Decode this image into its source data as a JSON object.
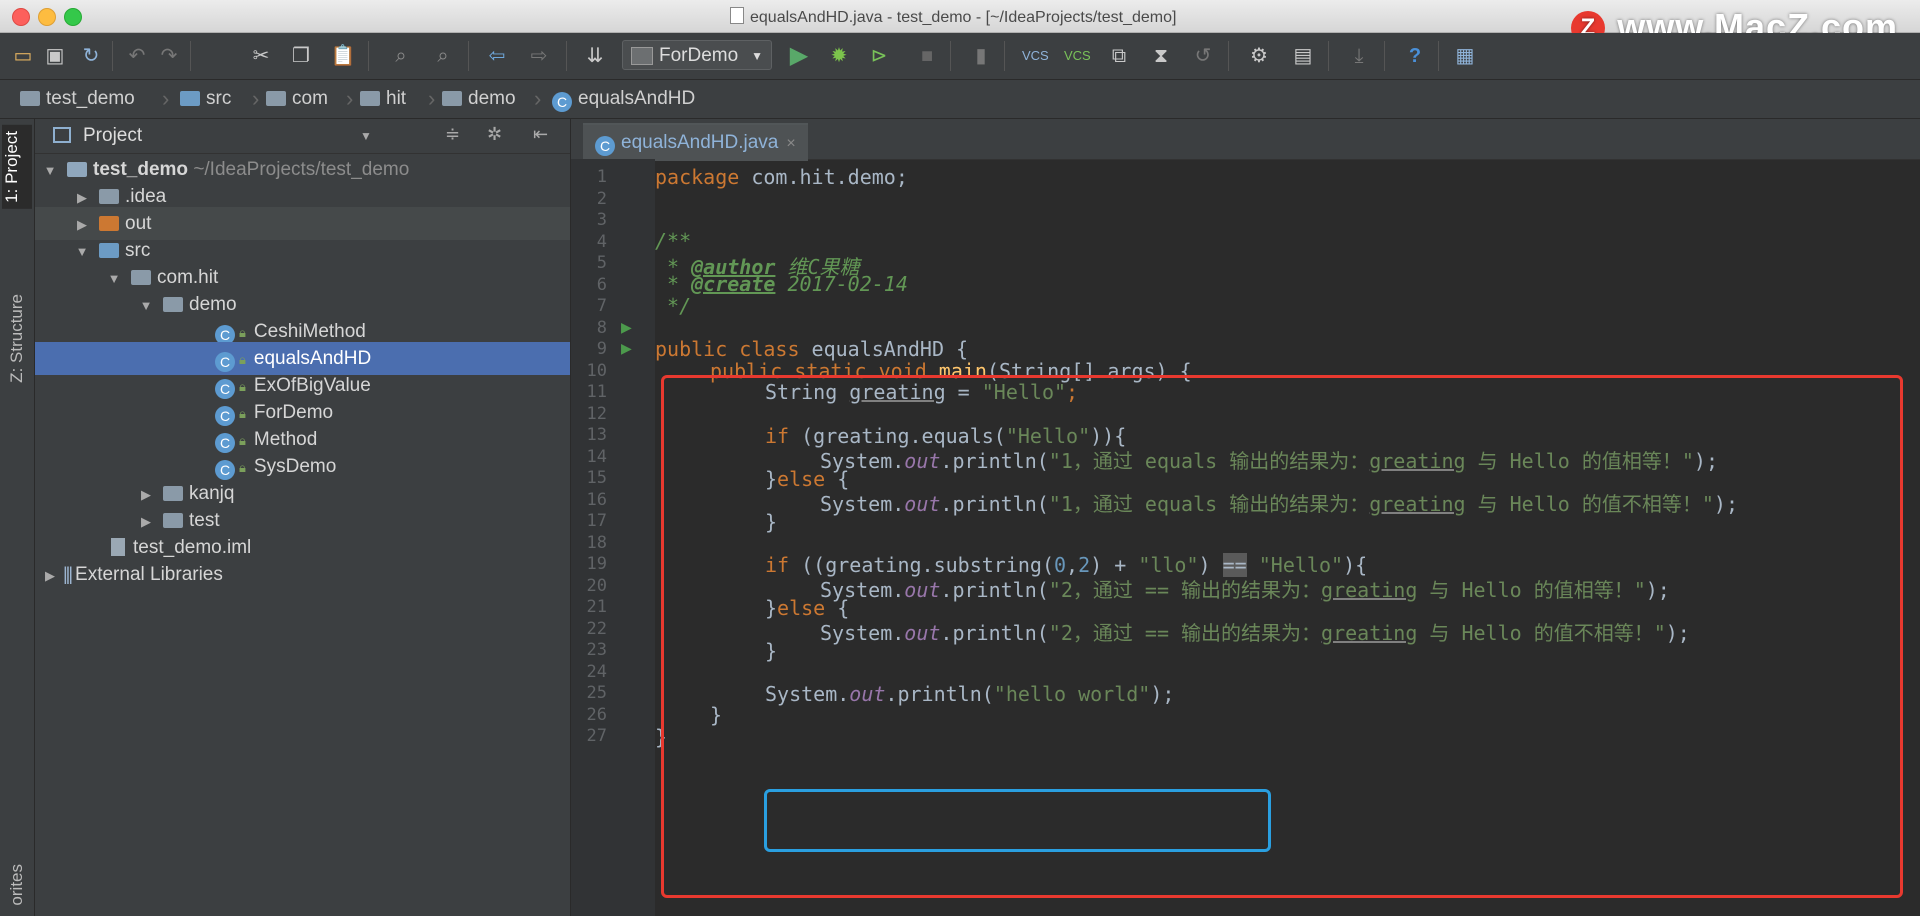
{
  "window": {
    "title": "equalsAndHD.java - test_demo - [~/IdeaProjects/test_demo]"
  },
  "watermark": {
    "text": "www.MacZ.com",
    "logo_letter": "Z"
  },
  "toolbar": {
    "run_config": "ForDemo"
  },
  "breadcrumbs": [
    "test_demo",
    "src",
    "com",
    "hit",
    "demo",
    "equalsAndHD"
  ],
  "sidebar": {
    "project_tab": "1: Project",
    "structure_tab": "Z: Structure",
    "favorites_tab": "orites"
  },
  "project": {
    "header": "Project",
    "tree": [
      {
        "label": "test_demo",
        "hint": "~/IdeaProjects/test_demo"
      },
      {
        "label": ".idea"
      },
      {
        "label": "out"
      },
      {
        "label": "src"
      },
      {
        "label": "com.hit"
      },
      {
        "label": "demo"
      },
      {
        "label": "CeshiMethod"
      },
      {
        "label": "equalsAndHD"
      },
      {
        "label": "ExOfBigValue"
      },
      {
        "label": "ForDemo"
      },
      {
        "label": "Method"
      },
      {
        "label": "SysDemo"
      },
      {
        "label": "kanjq"
      },
      {
        "label": "test"
      },
      {
        "label": "test_demo.iml"
      },
      {
        "label": "External Libraries"
      }
    ]
  },
  "editor": {
    "tab": "equalsAndHD.java",
    "line_numbers": [
      "1",
      "2",
      "3",
      "4",
      "5",
      "6",
      "7",
      "8",
      "9",
      "10",
      "11",
      "12",
      "13",
      "14",
      "15",
      "16",
      "17",
      "18",
      "19",
      "20",
      "21",
      "22",
      "23",
      "24",
      "25",
      "26",
      "27"
    ]
  },
  "code": {
    "l1_kw": "package",
    "l1_rest": " com.hit.demo;",
    "l3": "/**",
    "l4_pre": " * ",
    "l4_tag": "@author",
    "l4_txt": " 维C果糖",
    "l5_pre": " * ",
    "l5_tag": "@create",
    "l5_txt": " 2017-02-14",
    "l6": " */",
    "l8_kw": "public class",
    "l8_rest": " equalsAndHD {",
    "l9_kw": "public static void",
    "l9_fn": "main",
    "l9_rest": "(String[] args) {",
    "l10_a": "String ",
    "l10_var": "greating",
    "l10_b": " = ",
    "l10_str": "\"Hello\"",
    "l10_c": ";",
    "l12_kw": "if",
    "l12_a": " (greating.equals(",
    "l12_str": "\"Hello\"",
    "l12_b": ")){",
    "l13_a": "System.",
    "l13_out": "out",
    "l13_b": ".println(",
    "l13_s1": "\"1，通过 equals 输出的结果为：",
    "l13_ul": "greating",
    "l13_s2": " 与 Hello 的值相等！\"",
    "l13_c": ");",
    "l14_a": "}",
    "l14_kw": "else",
    "l14_b": " {",
    "l15_a": "System.",
    "l15_out": "out",
    "l15_b": ".println(",
    "l15_s1": "\"1，通过 equals 输出的结果为：",
    "l15_ul": "greating",
    "l15_s2": " 与 Hello 的值不相等！\"",
    "l15_c": ");",
    "l16": "}",
    "l18_kw": "if",
    "l18_a": " ((greating.substring(",
    "l18_n1": "0",
    "l18_b": ",",
    "l18_n2": "2",
    "l18_c": ") + ",
    "l18_s1": "\"llo\"",
    "l18_d": ") ",
    "l18_op": "==",
    "l18_e": " ",
    "l18_s2": "\"Hello\"",
    "l18_f": "){",
    "l19_a": "System.",
    "l19_out": "out",
    "l19_b": ".println(",
    "l19_s1": "\"2，通过 == 输出的结果为：",
    "l19_ul": "greating",
    "l19_s2": " 与 Hello 的值相等！\"",
    "l19_c": ");",
    "l20_a": "}",
    "l20_kw": "else",
    "l20_b": " {",
    "l21_a": "System.",
    "l21_out": "out",
    "l21_b": ".println(",
    "l21_s1": "\"2，通过 == 输出的结果为：",
    "l21_ul": "greating",
    "l21_s2": " 与 Hello 的值不相等！\"",
    "l21_c": ");",
    "l22": "}",
    "l24_a": "System.",
    "l24_out": "out",
    "l24_b": ".println(",
    "l24_str": "\"hello world\"",
    "l24_c": ");",
    "l25": "}",
    "l26": "}"
  },
  "colors": {
    "highlight_red": "#e8392f",
    "highlight_blue": "#2a9fe0",
    "selection": "#4b6eaf"
  }
}
